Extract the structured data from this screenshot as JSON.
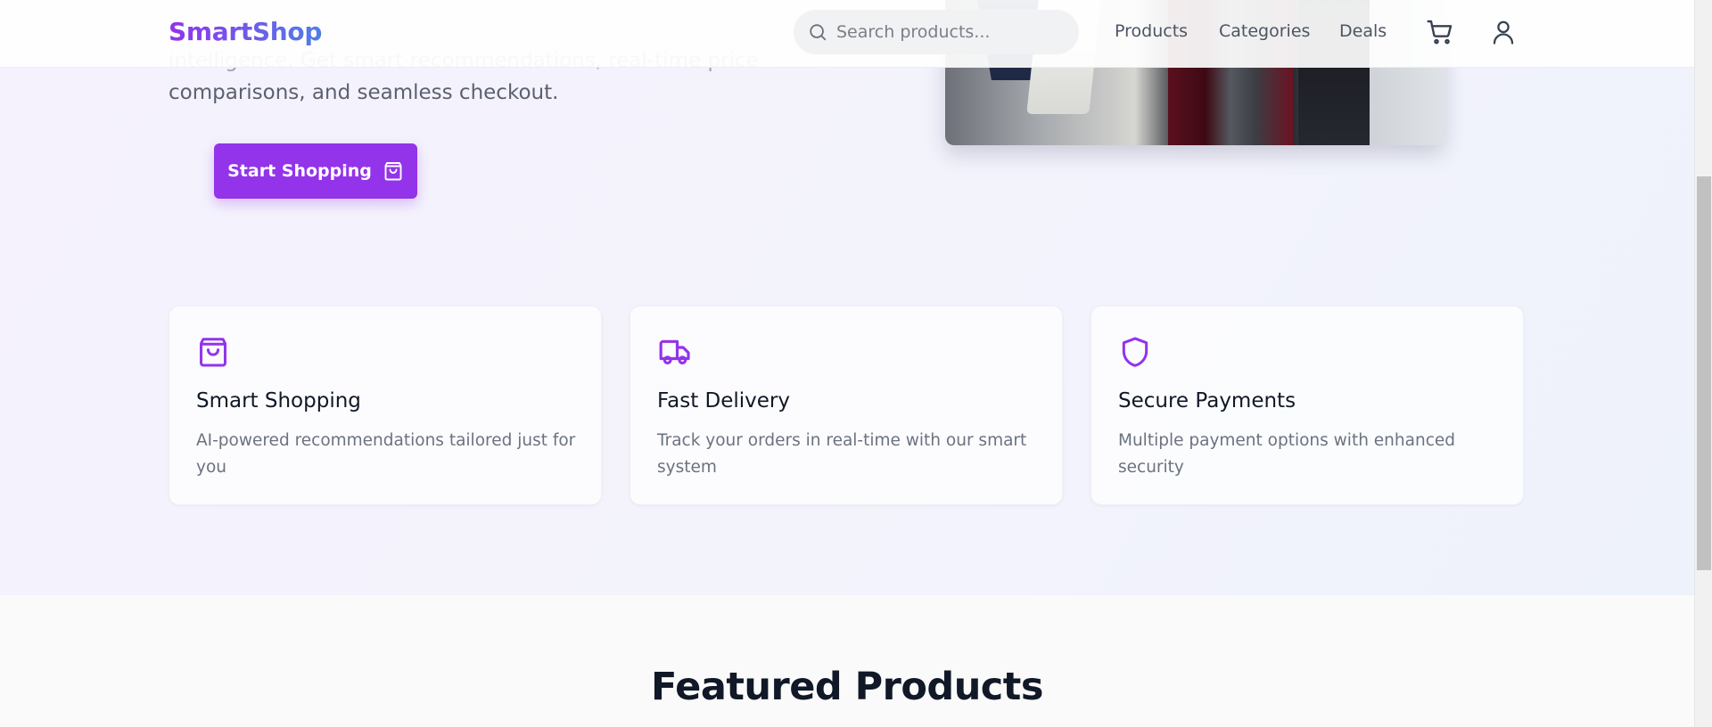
{
  "header": {
    "logo": "SmartShop",
    "search_placeholder": "Search products...",
    "nav": [
      "Products",
      "Categories",
      "Deals"
    ],
    "icons": {
      "search": "search-icon",
      "cart": "cart-icon",
      "user": "user-icon"
    }
  },
  "hero": {
    "text_line_1": "intelligence. Get smart recommendations, real-time price",
    "text_line_2": "comparisons, and seamless checkout.",
    "cta_label": "Start Shopping",
    "cta_icon": "shopping-bag-icon",
    "image": "shopping-bags-photo"
  },
  "features": [
    {
      "icon": "shopping-bag-icon",
      "title": "Smart Shopping",
      "description": "AI-powered recommendations tailored just for you"
    },
    {
      "icon": "truck-icon",
      "title": "Fast Delivery",
      "description": "Track your orders in real-time with our smart system"
    },
    {
      "icon": "shield-icon",
      "title": "Secure Payments",
      "description": "Multiple payment options with enhanced security"
    }
  ],
  "featured_heading": "Featured Products",
  "colors": {
    "accent": "#9333ea",
    "logo_gradient_end": "#4f7fe6",
    "heading": "#111827",
    "muted": "#6b7280"
  }
}
